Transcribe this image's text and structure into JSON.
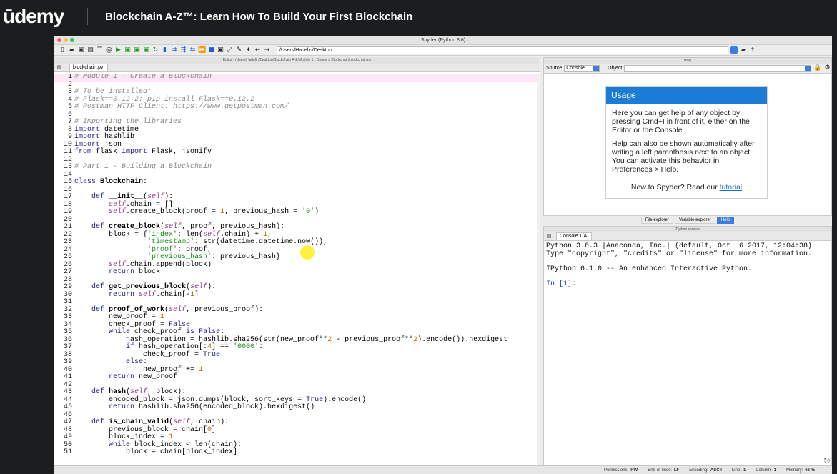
{
  "header": {
    "logo": "ūdemy",
    "course_title": "Blockchain A-Z™: Learn How To Build Your First Blockchain"
  },
  "window": {
    "title": "Spyder (Python 3.6)",
    "path": "/Users/Hadelin/Desktop"
  },
  "editor": {
    "pane_title": "Editor - /Users/Hadelin/Desktop/Blockchain A-Z/Module 1 - Create a Blockchain/blockchain.py",
    "tab": "blockchain.py",
    "lines": [
      {
        "n": "1",
        "h": "<span class=\"cm\"># Module 1 - Create a Blockchain</span>"
      },
      {
        "n": "2",
        "h": ""
      },
      {
        "n": "3",
        "h": "<span class=\"cm\"># To be installed:</span>"
      },
      {
        "n": "4",
        "h": "<span class=\"cm\"># Flask==0.12.2: pip install Flask==0.12.2</span>"
      },
      {
        "n": "5",
        "h": "<span class=\"cm\"># Postman HTTP Client: https://www.getpostman.com/</span>"
      },
      {
        "n": "6",
        "h": ""
      },
      {
        "n": "7",
        "h": "<span class=\"cm\"># Importing the libraries</span>"
      },
      {
        "n": "8",
        "h": "<span class=\"kw\">import</span> datetime"
      },
      {
        "n": "9",
        "h": "<span class=\"kw\">import</span> hashlib"
      },
      {
        "n": "10",
        "h": "<span class=\"kw\">import</span> json"
      },
      {
        "n": "11",
        "h": "<span class=\"kw\">from</span> flask <span class=\"kw\">import</span> Flask, jsonify"
      },
      {
        "n": "12",
        "h": ""
      },
      {
        "n": "13",
        "h": "<span class=\"cm\"># Part 1 - Building a Blockchain</span>"
      },
      {
        "n": "14",
        "h": ""
      },
      {
        "n": "15",
        "h": "<span class=\"kw\">class</span> <span class=\"b\">Blockchain</span>:"
      },
      {
        "n": "16",
        "h": ""
      },
      {
        "n": "17",
        "h": "    <span class=\"kw\">def</span> <span class=\"b\">__init__</span>(<span class=\"self\">self</span>):"
      },
      {
        "n": "18",
        "h": "        <span class=\"self\">self</span>.chain = []"
      },
      {
        "n": "19",
        "h": "        <span class=\"self\">self</span>.create_block(proof = <span class=\"num\">1</span>, previous_hash = <span class=\"str\">'0'</span>)"
      },
      {
        "n": "20",
        "h": ""
      },
      {
        "n": "21",
        "h": "    <span class=\"kw\">def</span> <span class=\"b\">create_block</span>(<span class=\"self\">self</span>, proof, previous_hash):"
      },
      {
        "n": "22",
        "h": "        block = {<span class=\"str\">'index'</span>: len(<span class=\"self\">self</span>.chain) + <span class=\"num\">1</span>,"
      },
      {
        "n": "23",
        "h": "                 <span class=\"str\">'timestamp'</span>: str(datetime.datetime.now()),"
      },
      {
        "n": "24",
        "h": "                 <span class=\"str\">'proof'</span>: proof,"
      },
      {
        "n": "25",
        "h": "                 <span class=\"str\">'previous_hash'</span>: previous_hash}"
      },
      {
        "n": "26",
        "h": "        <span class=\"self\">self</span>.chain.append(block)"
      },
      {
        "n": "27",
        "h": "        <span class=\"kw\">return</span> block"
      },
      {
        "n": "28",
        "h": ""
      },
      {
        "n": "29",
        "h": "    <span class=\"kw\">def</span> <span class=\"b\">get_previous_block</span>(<span class=\"self\">self</span>):"
      },
      {
        "n": "30",
        "h": "        <span class=\"kw\">return</span> <span class=\"self\">self</span>.chain[-<span class=\"num\">1</span>]"
      },
      {
        "n": "31",
        "h": ""
      },
      {
        "n": "32",
        "h": "    <span class=\"kw\">def</span> <span class=\"b\">proof_of_work</span>(<span class=\"self\">self</span>, previous_proof):"
      },
      {
        "n": "33",
        "h": "        new_proof = <span class=\"num\">1</span>"
      },
      {
        "n": "34",
        "h": "        check_proof = <span class=\"kw\">False</span>"
      },
      {
        "n": "35",
        "h": "        <span class=\"kw\">while</span> check_proof <span class=\"kw\">is</span> <span class=\"kw\">False</span>:"
      },
      {
        "n": "36",
        "h": "            hash_operation = hashlib.sha256(str(new_proof**<span class=\"num\">2</span> - previous_proof**<span class=\"num\">2</span>).encode()).hexdigest"
      },
      {
        "n": "37",
        "h": "            <span class=\"kw\">if</span> hash_operation[:<span class=\"num\">4</span>] == <span class=\"str\">'0000'</span>:"
      },
      {
        "n": "38",
        "h": "                check_proof = <span class=\"kw\">True</span>"
      },
      {
        "n": "39",
        "h": "            <span class=\"kw\">else</span>:"
      },
      {
        "n": "40",
        "h": "                new_proof += <span class=\"num\">1</span>"
      },
      {
        "n": "41",
        "h": "        <span class=\"kw\">return</span> new_proof"
      },
      {
        "n": "42",
        "h": ""
      },
      {
        "n": "43",
        "h": "    <span class=\"kw\">def</span> <span class=\"b\">hash</span>(<span class=\"self\">self</span>, block):"
      },
      {
        "n": "44",
        "h": "        encoded_block = json.dumps(block, sort_keys = <span class=\"kw\">True</span>).encode()"
      },
      {
        "n": "45",
        "h": "        <span class=\"kw\">return</span> hashlib.sha256(encoded_block).hexdigest()"
      },
      {
        "n": "46",
        "h": ""
      },
      {
        "n": "47",
        "h": "    <span class=\"kw\">def</span> <span class=\"b\">is_chain_valid</span>(<span class=\"self\">self</span>, chain):"
      },
      {
        "n": "48",
        "h": "        previous_block = chain[<span class=\"num\">0</span>]"
      },
      {
        "n": "49",
        "h": "        block_index = <span class=\"num\">1</span>"
      },
      {
        "n": "50",
        "h": "        <span class=\"kw\">while</span> block_index &lt; len(chain):"
      },
      {
        "n": "51",
        "h": "            block = chain[block_index]"
      }
    ]
  },
  "help": {
    "pane_title": "Help",
    "source_label": "Source",
    "source_value": "Console",
    "object_label": "Object",
    "usage_title": "Usage",
    "usage_p1": "Here you can get help of any object by pressing Cmd+I in front of it, either on the Editor or the Console.",
    "usage_p2": "Help can also be shown automatically after writing a left parenthesis next to an object. You can activate this behavior in Preferences > Help.",
    "usage_foot": "New to Spyder? Read our ",
    "usage_link": "tutorial"
  },
  "panel_tabs": [
    "File explorer",
    "Variable explorer",
    "Help"
  ],
  "console": {
    "pane_title": "IPython console",
    "tab": "Console 1/A",
    "line1": "Python 3.6.3 |Anaconda, Inc.| (default, Oct  6 2017, 12:04:38)",
    "line2": "Type \"copyright\", \"credits\" or \"license\" for more information.",
    "line3": "IPython 6.1.0 -- An enhanced Interactive Python.",
    "prompt": "In [1]:"
  },
  "statusbar": [
    {
      "label": "Permissions:",
      "value": "RW"
    },
    {
      "label": "End-of-lines:",
      "value": "LF"
    },
    {
      "label": "Encoding:",
      "value": "ASCII"
    },
    {
      "label": "Line:",
      "value": "1"
    },
    {
      "label": "Column:",
      "value": "1"
    },
    {
      "label": "Memory:",
      "value": "63 %"
    }
  ],
  "colors": {
    "accent": "#1c7bd4",
    "comment": "#888888",
    "string": "#1e8c1e",
    "keyword": "#1b1b8b"
  }
}
